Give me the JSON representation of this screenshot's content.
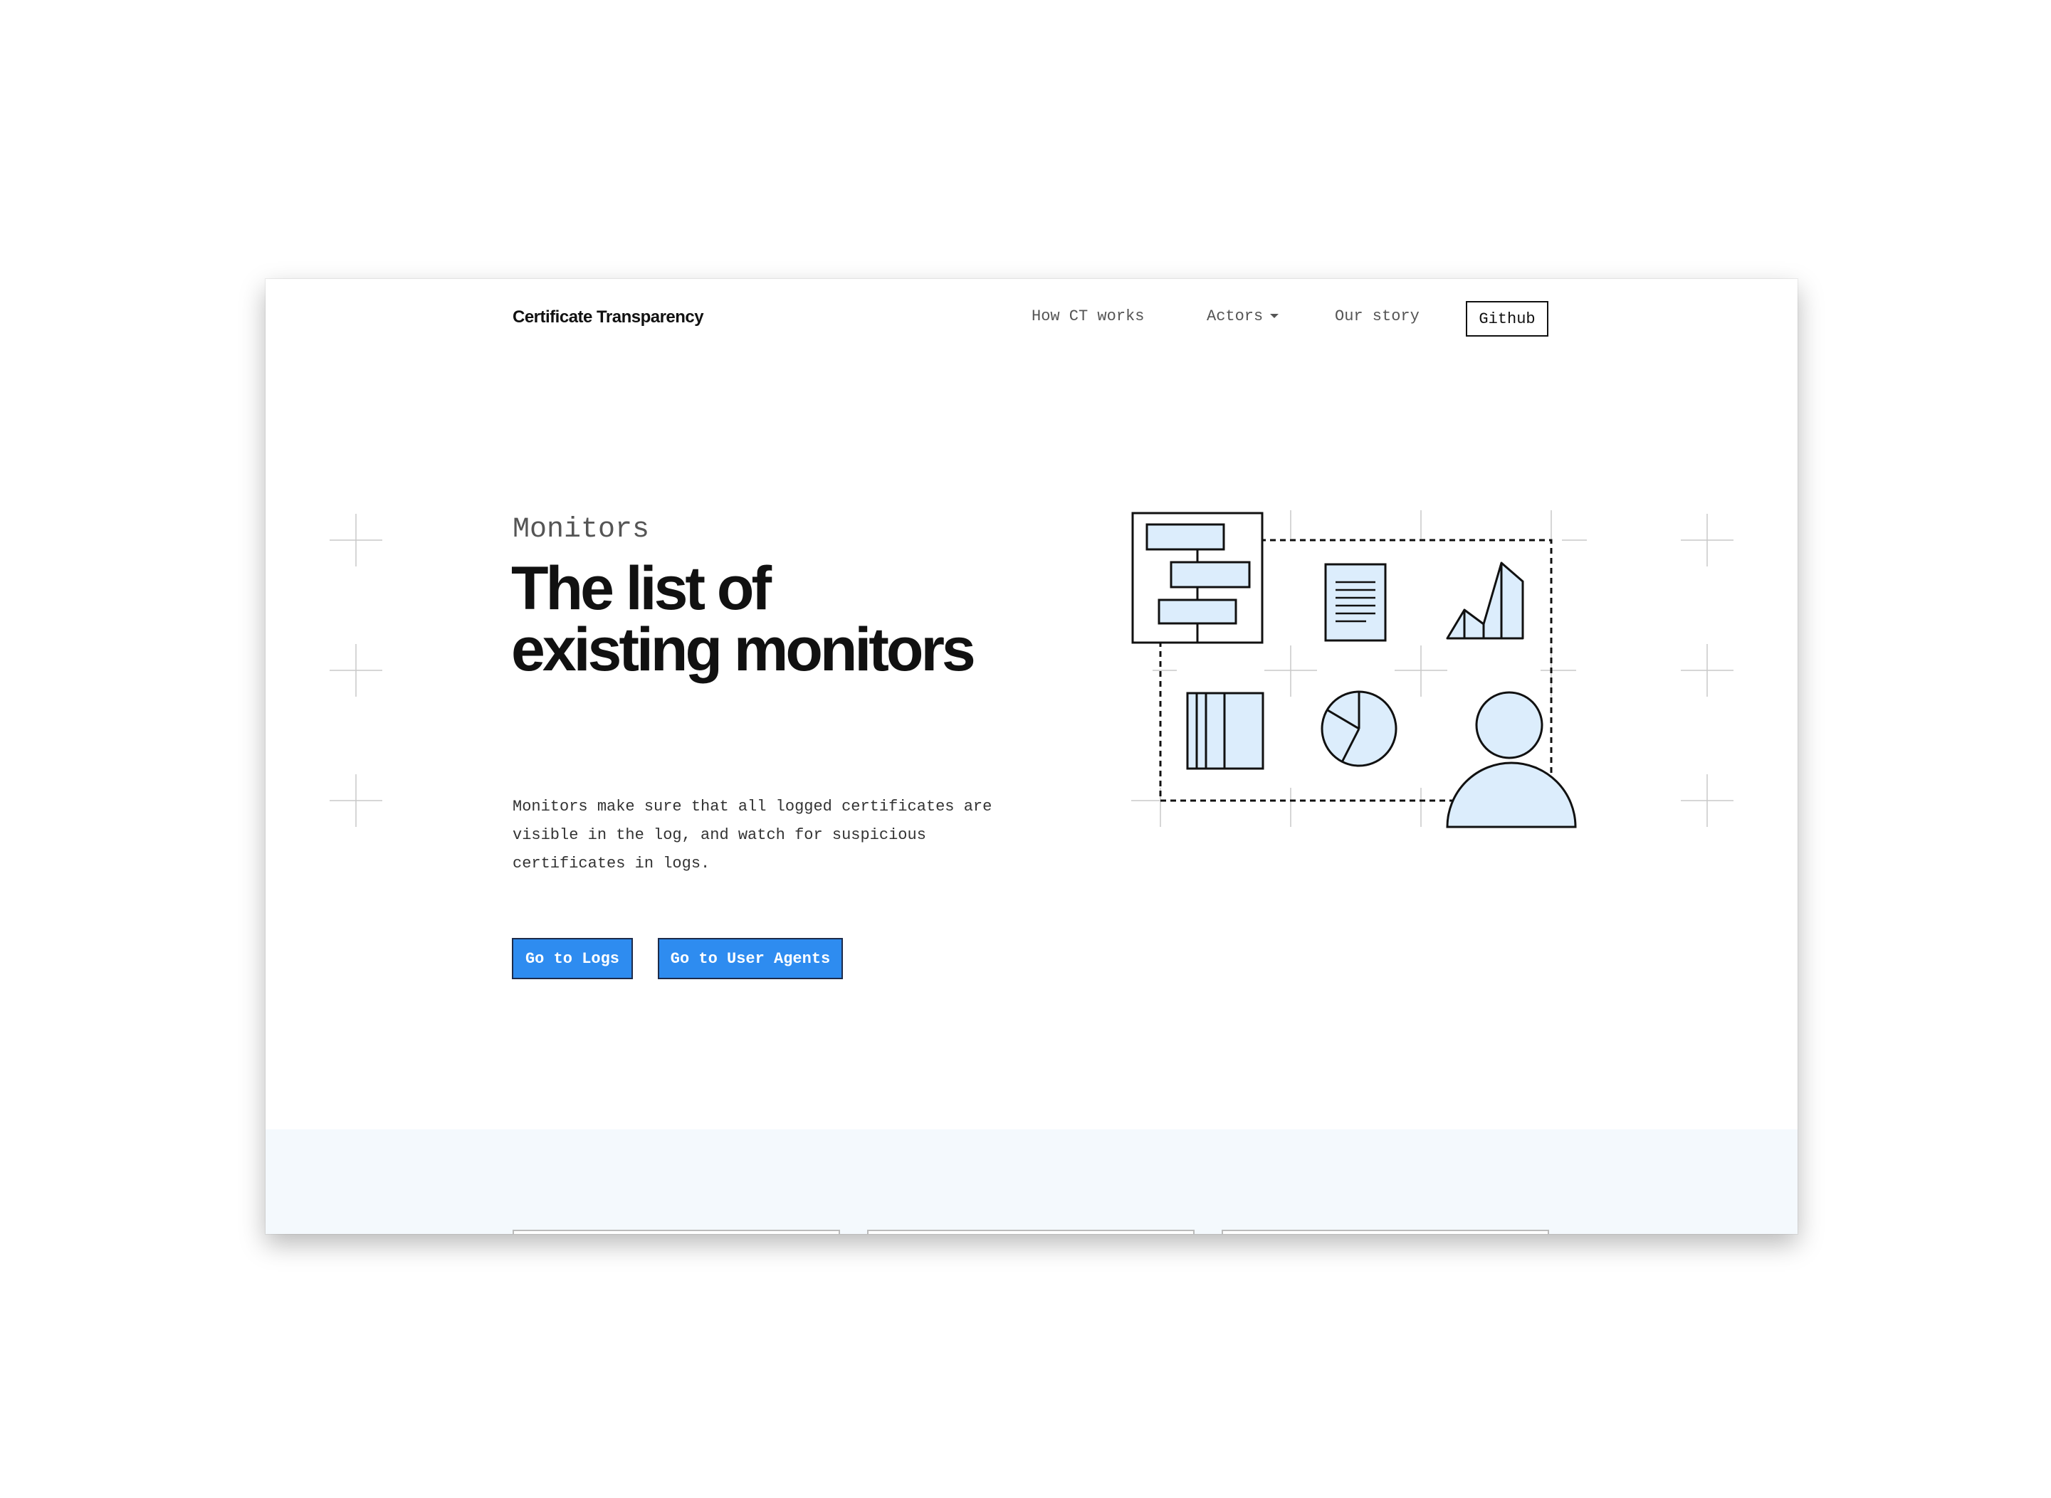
{
  "header": {
    "brand": "Certificate Transparency",
    "nav": {
      "how_ct_works": "How CT works",
      "actors": "Actors",
      "our_story": "Our story",
      "github": "Github"
    }
  },
  "hero": {
    "eyebrow": "Monitors",
    "title_line1": "The list of",
    "title_line2": "existing monitors",
    "description": "Monitors make sure that all logged certificates are visible in the log, and watch for suspicious certificates in logs.",
    "buttons": {
      "logs": "Go to Logs",
      "user_agents": "Go to User Agents"
    }
  },
  "colors": {
    "accent": "#2e8cf0",
    "illustration_fill": "#dcedfc",
    "band_background": "#f4f9fd"
  }
}
